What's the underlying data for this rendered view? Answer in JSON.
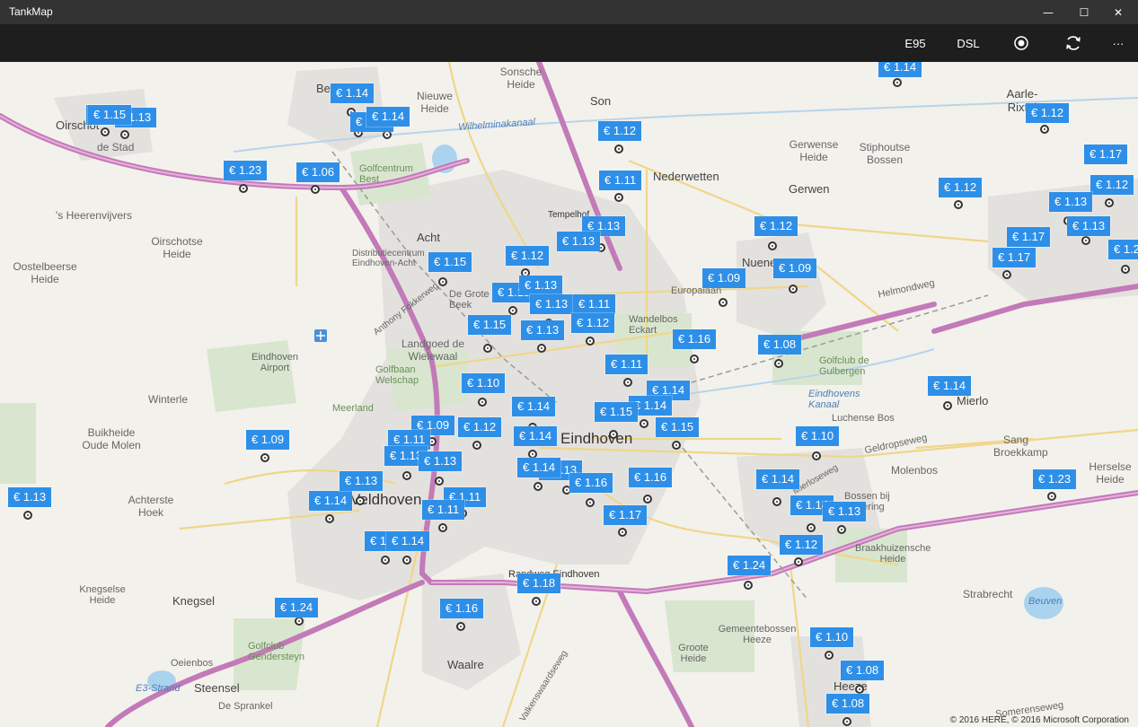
{
  "app": {
    "title": "TankMap"
  },
  "window_controls": {
    "minimize": "—",
    "maximize": "☐",
    "close": "✕"
  },
  "toolbar": {
    "e95": "E95",
    "dsl": "DSL",
    "record_icon": "record-icon",
    "refresh_icon": "refresh-icon",
    "more": "···"
  },
  "map": {
    "copyright": "© 2016 HERE, © 2016 Microsoft Corporation",
    "places": [
      {
        "name": "Best"
      },
      {
        "name": "Nieuwe Heide"
      },
      {
        "name": "Sonsche Heide"
      },
      {
        "name": "Son"
      },
      {
        "name": "Oirschot"
      },
      {
        "name": "de Stad"
      },
      {
        "name": "Golfcentrum Best"
      },
      {
        "name": "Nederwetten"
      },
      {
        "name": "Gerwen"
      },
      {
        "name": "Gerwense Heide"
      },
      {
        "name": "Stiphoutse Bossen"
      },
      {
        "name": "Aarle-Rixtel"
      },
      {
        "name": "'s Heerenvijvers"
      },
      {
        "name": "Oirschotse Heide"
      },
      {
        "name": "Oostelbeerse Heide"
      },
      {
        "name": "Acht"
      },
      {
        "name": "Distributiecentrum Eindhoven-Acht"
      },
      {
        "name": "Tempelhof"
      },
      {
        "name": "De Grote Beek"
      },
      {
        "name": "Nuenen"
      },
      {
        "name": "Europalaan"
      },
      {
        "name": "Helmondweg"
      },
      {
        "name": "Wandelbos Eckart"
      },
      {
        "name": "Eindhoven Airport"
      },
      {
        "name": "Landgoed de Wielewaal"
      },
      {
        "name": "Golfbaan Welschap"
      },
      {
        "name": "Golfclub de Gulbergen"
      },
      {
        "name": "Eindhovens Kanaal"
      },
      {
        "name": "Luchense Bos"
      },
      {
        "name": "Mierlo"
      },
      {
        "name": "Winterle"
      },
      {
        "name": "Meerland"
      },
      {
        "name": "Eindhoven"
      },
      {
        "name": "Geldropseweg"
      },
      {
        "name": "Sang Broekkamp"
      },
      {
        "name": "Herselse Heide"
      },
      {
        "name": "Buikheide Oude Molen"
      },
      {
        "name": "Molenbos"
      },
      {
        "name": "Achterste Hoek"
      },
      {
        "name": "Veldhoven"
      },
      {
        "name": "Bossen bij Gevering"
      },
      {
        "name": "Braakhuizensche Heide"
      },
      {
        "name": "Knegselse Heide"
      },
      {
        "name": "Knegsel"
      },
      {
        "name": "Randweg Eindhoven"
      },
      {
        "name": "Strabrecht"
      },
      {
        "name": "Beuven"
      },
      {
        "name": "Golfclub Gendersteyn"
      },
      {
        "name": "Oeienbos"
      },
      {
        "name": "E3-Strand"
      },
      {
        "name": "Steensel"
      },
      {
        "name": "De Sprankel"
      },
      {
        "name": "Waalre"
      },
      {
        "name": "Gemeentebossen Heeze"
      },
      {
        "name": "Groote Heide"
      },
      {
        "name": "Heeze"
      },
      {
        "name": "Somerenseweg"
      },
      {
        "name": "Valkenswaardseweg"
      },
      {
        "name": "Wilhelminakanaal"
      },
      {
        "name": "Anthony Fokkerweg"
      },
      {
        "name": "Mierloseweg"
      }
    ],
    "stations": [
      {
        "price": "€ 1.14"
      },
      {
        "price": "€ 1.14"
      },
      {
        "price": "€ 1.15"
      },
      {
        "price": "€ 1.13"
      },
      {
        "price": "€ 1.14"
      },
      {
        "price": "€ 1.14"
      },
      {
        "price": "€ 1.12"
      },
      {
        "price": "€ 1.12"
      },
      {
        "price": "€ 1.23"
      },
      {
        "price": "€ 1.06"
      },
      {
        "price": "€ 1.11"
      },
      {
        "price": "€ 1.17"
      },
      {
        "price": "€ 1.12"
      },
      {
        "price": "€ 1.12"
      },
      {
        "price": "€ 1.13"
      },
      {
        "price": "€ 1.13"
      },
      {
        "price": "€ 1.13"
      },
      {
        "price": "€ 1.12"
      },
      {
        "price": "€ 1.17"
      },
      {
        "price": "€ 1.24"
      },
      {
        "price": "€ 1.16"
      },
      {
        "price": "€ 1.09"
      },
      {
        "price": "€ 1.15"
      },
      {
        "price": "€ 1.12"
      },
      {
        "price": "€ 1.09"
      },
      {
        "price": "€ 1.19"
      },
      {
        "price": "€ 1.13"
      },
      {
        "price": "€ 1.13"
      },
      {
        "price": "€ 1.11"
      },
      {
        "price": "€ 1.15"
      },
      {
        "price": "€ 1.13"
      },
      {
        "price": "€ 1.12"
      },
      {
        "price": "€ 1.16"
      },
      {
        "price": "€ 1.08"
      },
      {
        "price": "€ 1.11"
      },
      {
        "price": "€ 1.10"
      },
      {
        "price": "€ 1.14"
      },
      {
        "price": "€ 1.14"
      },
      {
        "price": "€ 1.14"
      },
      {
        "price": "€ 1.15"
      },
      {
        "price": "€ 1.14"
      },
      {
        "price": "€ 1.15"
      },
      {
        "price": "€ 1.09"
      },
      {
        "price": "€ 1.12"
      },
      {
        "price": "€ 1.09"
      },
      {
        "price": "€ 1.11"
      },
      {
        "price": "€ 1.14"
      },
      {
        "price": "€ 1.10"
      },
      {
        "price": "€ 1.13"
      },
      {
        "price": "€ 1.14"
      },
      {
        "price": "€ 1.13"
      },
      {
        "price": "€ 1.14"
      },
      {
        "price": "€ 1.16"
      },
      {
        "price": "€ 1.16"
      },
      {
        "price": "€ 1.14"
      },
      {
        "price": "€ 1.23"
      },
      {
        "price": "€ 1.13"
      },
      {
        "price": "€ 1.14"
      },
      {
        "price": "€ 1.11"
      },
      {
        "price": "€ 1.14"
      },
      {
        "price": "€ 1.11"
      },
      {
        "price": "€ 1.17"
      },
      {
        "price": "€ 1.14"
      },
      {
        "price": "€ 1.13"
      },
      {
        "price": "€ 1.12"
      },
      {
        "price": "€ 1.14"
      },
      {
        "price": "€ 1.14"
      },
      {
        "price": "€ 1.24"
      },
      {
        "price": "€ 1.18"
      },
      {
        "price": "€ 1.24"
      },
      {
        "price": "€ 1.16"
      },
      {
        "price": "€ 1.10"
      },
      {
        "price": "€ 1.08"
      },
      {
        "price": "€ 1.08"
      }
    ]
  }
}
